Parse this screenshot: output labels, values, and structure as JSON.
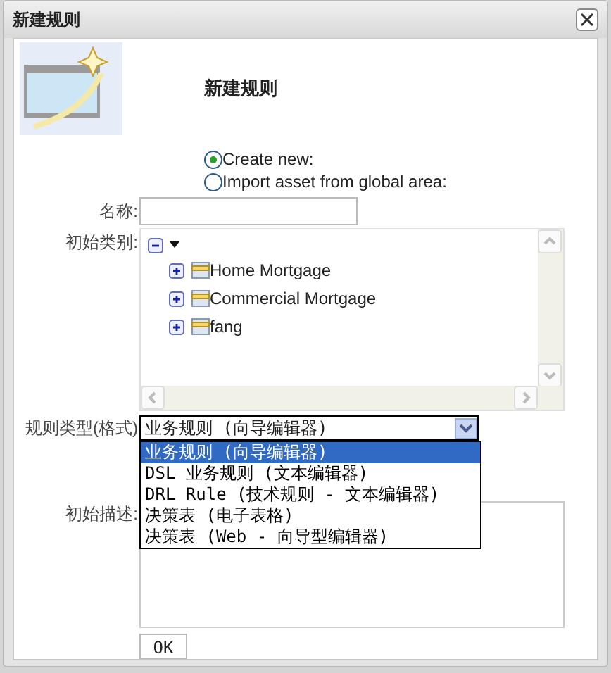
{
  "window": {
    "title": "新建规则"
  },
  "heading": "新建规则",
  "mode_options": [
    {
      "label": "Create new:",
      "selected": true
    },
    {
      "label": "Import asset from global area:",
      "selected": false
    }
  ],
  "name_field": {
    "label": "名称:"
  },
  "category": {
    "label": "初始类别:",
    "root": {
      "expanded": true,
      "children": [
        {
          "label": "Home Mortgage",
          "expanded": false
        },
        {
          "label": "Commercial Mortgage",
          "expanded": false
        },
        {
          "label": "fang",
          "expanded": false
        }
      ]
    }
  },
  "rule_type": {
    "label": "规则类型(格式)",
    "value": "业务规则 (向导编辑器)",
    "open": true,
    "options": [
      {
        "label": "业务规则 (向导编辑器)",
        "selected": true
      },
      {
        "label": "DSL 业务规则 (文本编辑器)",
        "selected": false
      },
      {
        "label": "DRL Rule (技术规则 - 文本编辑器)",
        "selected": false
      },
      {
        "label": "决策表 (电子表格)",
        "selected": false
      },
      {
        "label": "决策表 (Web - 向导型编辑器)",
        "selected": false
      }
    ]
  },
  "description": {
    "label": "初始描述:"
  },
  "buttons": [
    "OK"
  ]
}
